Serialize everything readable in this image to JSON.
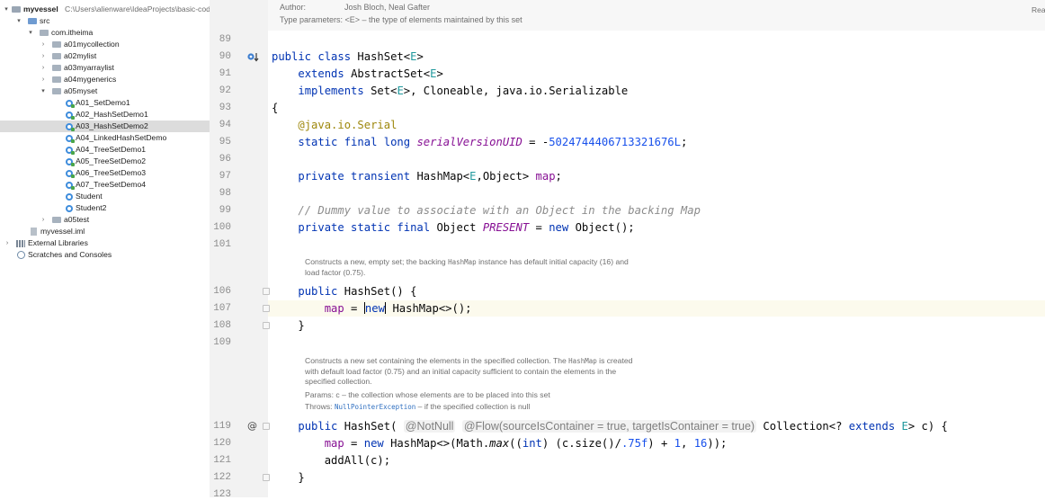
{
  "project": {
    "root": {
      "label": "myvessel",
      "path": "C:\\Users\\alienware\\IdeaProjects\\basic-cod"
    },
    "nodes": [
      {
        "label": "src"
      },
      {
        "label": "com.itheima"
      },
      {
        "label": "a01mycollection"
      },
      {
        "label": "a02mylist"
      },
      {
        "label": "a03myarraylist"
      },
      {
        "label": "a04mygenerics"
      },
      {
        "label": "a05myset"
      },
      {
        "label": "A01_SetDemo1"
      },
      {
        "label": "A02_HashSetDemo1"
      },
      {
        "label": "A03_HashSetDemo2"
      },
      {
        "label": "A04_LinkedHashSetDemo"
      },
      {
        "label": "A04_TreeSetDemo1"
      },
      {
        "label": "A05_TreeSetDemo2"
      },
      {
        "label": "A06_TreeSetDemo3"
      },
      {
        "label": "A07_TreeSetDemo4"
      },
      {
        "label": "Student"
      },
      {
        "label": "Student2"
      },
      {
        "label": "a05test"
      },
      {
        "label": "myvessel.iml"
      },
      {
        "label": "External Libraries"
      },
      {
        "label": "Scratches and Consoles"
      }
    ],
    "selected": "A03_HashSetDemo2"
  },
  "editor": {
    "header": {
      "author_label": "Author:",
      "author_value": "Josh Bloch, Neal Gafter",
      "type_params": "Type parameters: <E> – the type of elements maintained by this set",
      "reader_mode": "Rea"
    },
    "line_numbers": [
      "89",
      "90",
      "91",
      "92",
      "93",
      "94",
      "95",
      "96",
      "97",
      "98",
      "99",
      "100",
      "101",
      "106",
      "107",
      "108",
      "109",
      "119",
      "120",
      "121",
      "122",
      "123"
    ],
    "doc1": {
      "line1_a": "Constructs a new, empty set; the backing ",
      "line1_code": "HashMap",
      "line1_b": " instance has default initial capacity (16) and",
      "line2": "load factor (0.75)."
    },
    "doc2": {
      "line1_a": "Constructs a new set containing the elements in the specified collection. The ",
      "line1_code": "HashMap",
      "line1_b": " is created",
      "line2": "with default load factor (0.75) and an initial capacity sufficient to contain the elements in the",
      "line3": "specified collection.",
      "params": "Params: c – the collection whose elements are to be placed into this set",
      "throws_a": "Throws: ",
      "throws_link": "NullPointerException",
      "throws_b": " – if the specified collection is null"
    },
    "inlay_hints": {
      "notnull": "@NotNull",
      "flow": "@Flow(sourceIsContainer = true, targetIsContainer = true)"
    },
    "gutter_marks": {
      "override": "@"
    },
    "colors": {
      "keyword": "#0033b3",
      "type_param": "#20999d",
      "annotation": "#9e880d",
      "static_field": "#871094",
      "number": "#1750eb",
      "comment": "#8c8c8c",
      "current_line": "#fcfaed"
    }
  }
}
